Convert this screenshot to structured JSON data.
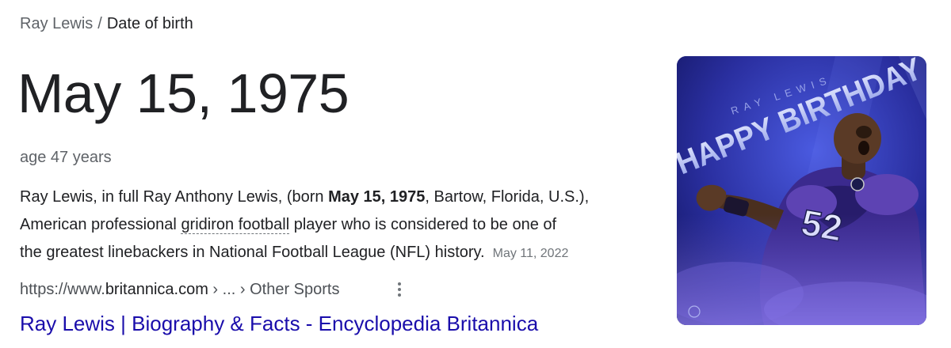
{
  "breadcrumb": {
    "entity": "Ray Lewis",
    "separator": "/",
    "attribute": "Date of birth"
  },
  "answer": "May 15, 1975",
  "subtext": "age 47 years",
  "snippet": {
    "line1_pre": "Ray Lewis, in full Ray Anthony Lewis, (born ",
    "line1_bold": "May 15, 1975",
    "line1_post": ", Bartow, Florida, U.S.),",
    "line2_pre": "American professional ",
    "line2_link": "gridiron football",
    "line2_post": " player who is considered to be one of",
    "line3": "the greatest linebackers in National Football League (NFL) history.",
    "date": "May 11, 2022"
  },
  "source": {
    "url_prefix": "https://www.",
    "domain": "britannica.com",
    "path": " › ... › Other Sports",
    "more_icon": "vertical-ellipsis-icon"
  },
  "result": {
    "title": "Ray Lewis | Biography & Facts - Encyclopedia Britannica"
  },
  "image": {
    "name_text": "RAY LEWIS",
    "headline": "HAPPY BIRTHDAY",
    "jersey_number": "52",
    "colors": {
      "bg_dark": "#14176b",
      "bg_light": "#3a47c9",
      "purple": "#5b3fa8",
      "text": "#c9d4ff"
    }
  }
}
